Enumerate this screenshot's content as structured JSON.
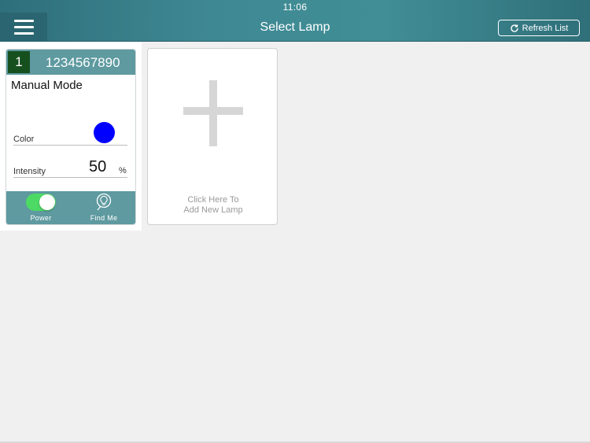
{
  "status_bar": {
    "time": "11:06"
  },
  "header": {
    "title": "Select Lamp",
    "menu_icon": "hamburger-icon",
    "refresh_label": "Refresh List",
    "refresh_icon": "refresh-icon"
  },
  "lamp": {
    "number": "1",
    "id": "1234567890",
    "mode": "Manual Mode",
    "color_label": "Color",
    "color_value": "#0000ff",
    "intensity_label": "Intensity",
    "intensity_value": "50",
    "intensity_unit": "%",
    "power_label": "Power",
    "power_on": true,
    "find_label": "Find Me",
    "find_icon": "lightbulb-icon"
  },
  "add_card": {
    "line1": "Click Here To",
    "line2": "Add New Lamp",
    "icon": "plus-icon"
  },
  "colors": {
    "header": "#3e8893",
    "card_bar": "#5e9aa0",
    "badge": "#17501f",
    "toggle_on": "#4cd964"
  }
}
